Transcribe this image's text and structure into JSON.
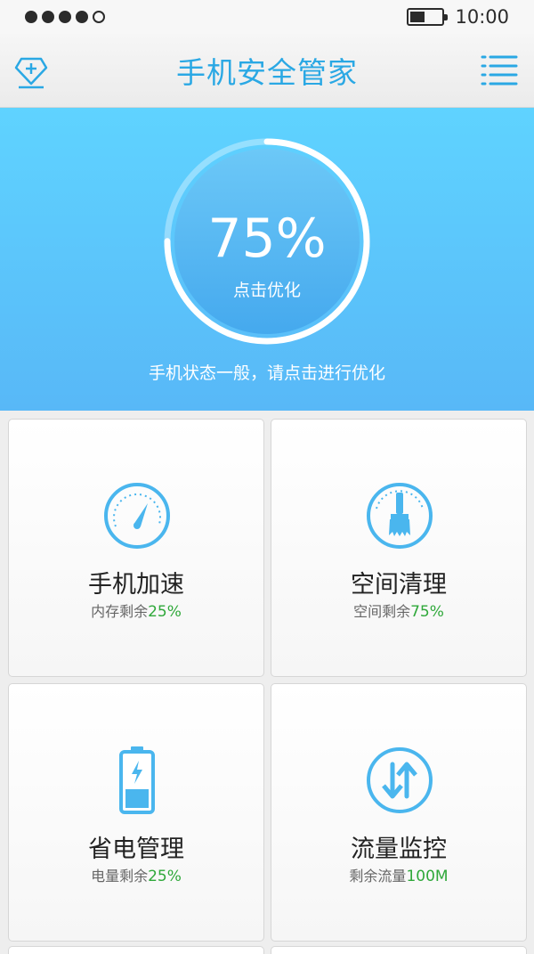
{
  "status_bar": {
    "time": "10:00",
    "battery_level": 0.45
  },
  "header": {
    "title": "手机安全管家",
    "left_icon": "diamond-plus-icon",
    "right_icon": "menu-icon"
  },
  "hero": {
    "percent_text": "75%",
    "percent_value": 75,
    "tap_label": "点击优化",
    "status_message": "手机状态一般，请点击进行优化",
    "colors": {
      "top": "#5fd3ff",
      "bottom": "#58b8f7"
    }
  },
  "cards": [
    {
      "title": "手机加速",
      "sub_label": "内存剩余",
      "sub_value": "25%",
      "icon": "speedometer-icon"
    },
    {
      "title": "空间清理",
      "sub_label": "空间剩余",
      "sub_value": "75%",
      "icon": "brush-icon"
    },
    {
      "title": "省电管理",
      "sub_label": "电量剩余",
      "sub_value": "25%",
      "icon": "battery-icon"
    },
    {
      "title": "流量监控",
      "sub_label": "剩余流量",
      "sub_value": "100M",
      "icon": "transfer-arrows-icon"
    }
  ],
  "colors": {
    "accent": "#2aa8e4",
    "icon_blue": "#4ab6ee",
    "value_green": "#2fa83a"
  }
}
